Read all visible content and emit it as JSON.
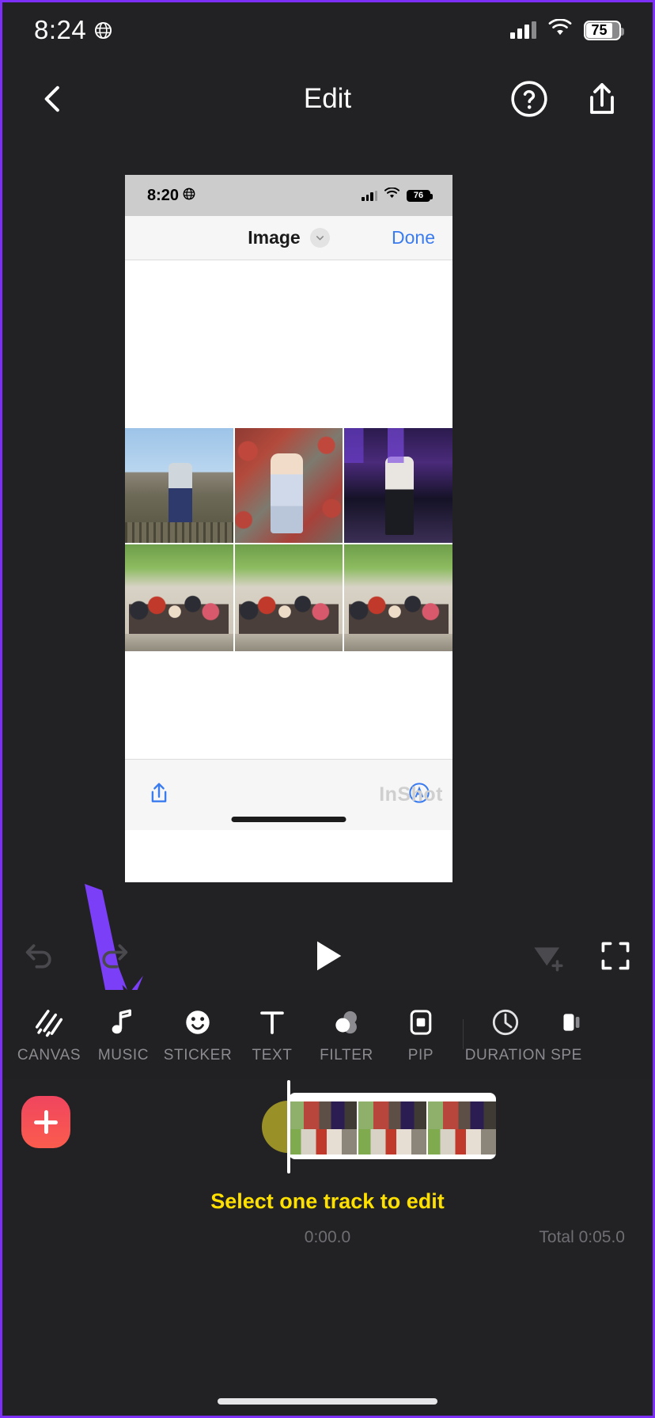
{
  "status_bar": {
    "time": "8:24",
    "location_icon": "globe-icon",
    "signal_icon": "cellular-bars-icon",
    "wifi_icon": "wifi-icon",
    "battery_percent": "75"
  },
  "header": {
    "back_icon": "chevron-left-icon",
    "title": "Edit",
    "help_icon": "question-circle-icon",
    "share_icon": "share-up-icon"
  },
  "preview": {
    "inner_status": {
      "time": "8:20",
      "location_icon": "globe-icon",
      "signal_icon": "cellular-bars-icon",
      "wifi_icon": "wifi-icon",
      "battery_percent": "76"
    },
    "inner_navbar": {
      "title": "Image",
      "chevron_icon": "chevron-down-icon",
      "done_label": "Done"
    },
    "inner_toolbar": {
      "share_icon": "share-up-icon",
      "markup_icon": "markup-circle-icon"
    },
    "watermark": "InShot"
  },
  "player": {
    "undo_icon": "undo-arrow-icon",
    "redo_icon": "redo-arrow-icon",
    "play_icon": "play-triangle-icon",
    "keyframe_icon": "keyframe-add-icon",
    "fullscreen_icon": "fullscreen-expand-icon"
  },
  "toolbar": {
    "items": [
      {
        "label": "CANVAS",
        "icon": "canvas-stripes-icon"
      },
      {
        "label": "MUSIC",
        "icon": "music-note-icon"
      },
      {
        "label": "STICKER",
        "icon": "smiley-face-icon"
      },
      {
        "label": "TEXT",
        "icon": "text-t-icon"
      },
      {
        "label": "FILTER",
        "icon": "filter-circles-icon"
      },
      {
        "label": "PIP",
        "icon": "pip-square-icon"
      },
      {
        "label": "DURATION",
        "icon": "clock-icon"
      },
      {
        "label": "SPE",
        "icon": "speed-icon"
      }
    ]
  },
  "timeline": {
    "add_button_icon": "plus-icon",
    "hint": "Select one track to edit",
    "current_time": "0:00.0",
    "total_time": "Total 0:05.0",
    "clip_frames": 3
  },
  "annotation": {
    "arrow_icon": "pointer-arrow-icon",
    "arrow_color": "#7b3ff7",
    "points_to": "MUSIC"
  },
  "colors": {
    "background": "#222224",
    "toolstrip": "#212123",
    "hint_yellow": "#ffe000",
    "add_button": "#f0455f",
    "accent_blue": "#3a7bf0",
    "border_purple": "#7b2ff7"
  }
}
